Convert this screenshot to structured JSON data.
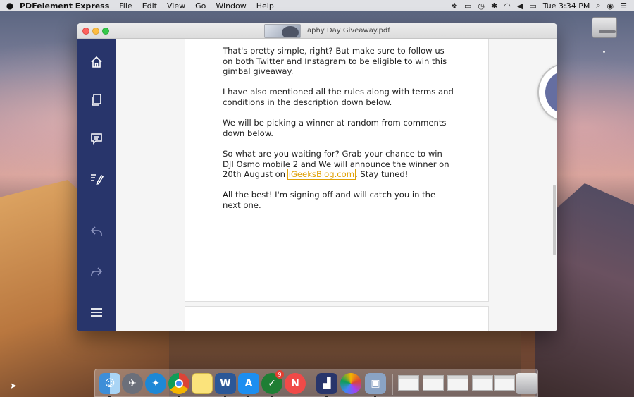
{
  "menubar": {
    "apple_icon": "apple-icon",
    "app_name": "PDFelement Express",
    "menus": [
      "File",
      "Edit",
      "View",
      "Go",
      "Window",
      "Help"
    ],
    "clock": "Tue 3:34 PM",
    "status_icons": [
      "dropbox-icon",
      "screen-icon",
      "time-machine-icon",
      "bluetooth-icon",
      "wifi-icon",
      "volume-icon",
      "battery-icon",
      "search-icon",
      "siri-icon",
      "list-icon"
    ]
  },
  "window": {
    "title": "aphy Day Giveaway.pdf",
    "sidebar": [
      "home-icon",
      "pages-icon",
      "comment-icon",
      "edit-icon",
      "undo-icon",
      "redo-icon",
      "menu-icon"
    ]
  },
  "document": {
    "paragraphs": [
      "That's pretty simple, right? But make sure to follow us on both Twitter and Instagram to be eligible to win this gimbal giveaway.",
      "I have also mentioned all the rules along with terms and conditions in the description down below.",
      "We will be picking a winner at random from comments down below."
    ],
    "p4_before": "So what are you waiting for? Grab your chance to win DJI Osmo mobile 2 and We will announce the winner on 20th August on ",
    "p4_link": "iGeeksBlog.com",
    "p4_after": ". Stay tuned!",
    "p5": "All the best! I'm signing off and will catch you in the next one.",
    "link_color": "#e0a106"
  },
  "controls": {
    "link_button_icon": "link-icon",
    "plus_label": "+",
    "minus_label": "−"
  },
  "dock": {
    "apps": [
      "Finder",
      "Launchpad",
      "Safari",
      "Chrome",
      "Notes",
      "Word",
      "App Store",
      "Wunderlist",
      "News",
      "PDFelement",
      "Photos",
      "Preview"
    ],
    "badge": "9"
  },
  "colors": {
    "sidebar": "#28356b",
    "accent": "#424f84"
  }
}
